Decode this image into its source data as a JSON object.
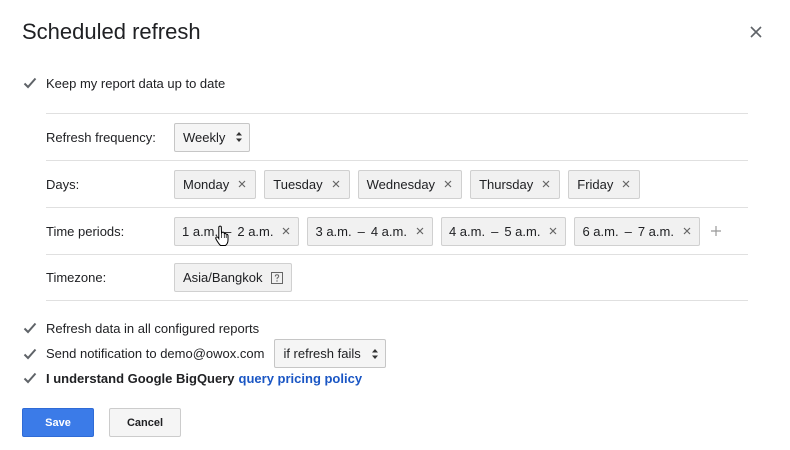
{
  "dialog": {
    "title": "Scheduled refresh"
  },
  "keep_up_to_date": {
    "label": "Keep my report data up to date",
    "checked": true
  },
  "settings": {
    "frequency": {
      "label": "Refresh frequency:",
      "value": "Weekly"
    },
    "days": {
      "label": "Days:",
      "items": [
        "Monday",
        "Tuesday",
        "Wednesday",
        "Thursday",
        "Friday"
      ]
    },
    "time_periods": {
      "label": "Time periods:",
      "items": [
        {
          "start": "1 a.m.",
          "end": "2 a.m."
        },
        {
          "start": "3 a.m.",
          "end": "4 a.m."
        },
        {
          "start": "4 a.m.",
          "end": "5 a.m."
        },
        {
          "start": "6 a.m.",
          "end": "7 a.m."
        }
      ],
      "separator": "–"
    },
    "timezone": {
      "label": "Timezone:",
      "value": "Asia/Bangkok"
    }
  },
  "options": {
    "refresh_all": {
      "label": "Refresh data in all configured reports",
      "checked": true
    },
    "notification": {
      "label": "Send notification to demo@owox.com",
      "checked": true,
      "condition": "if refresh fails"
    },
    "pricing": {
      "label_prefix": "I understand Google BigQuery",
      "link_text": "query pricing policy",
      "checked": true
    }
  },
  "buttons": {
    "save": "Save",
    "cancel": "Cancel"
  },
  "colors": {
    "accent": "#3b7be8",
    "link": "#1a56c4",
    "checkbox": "#5f6368"
  }
}
